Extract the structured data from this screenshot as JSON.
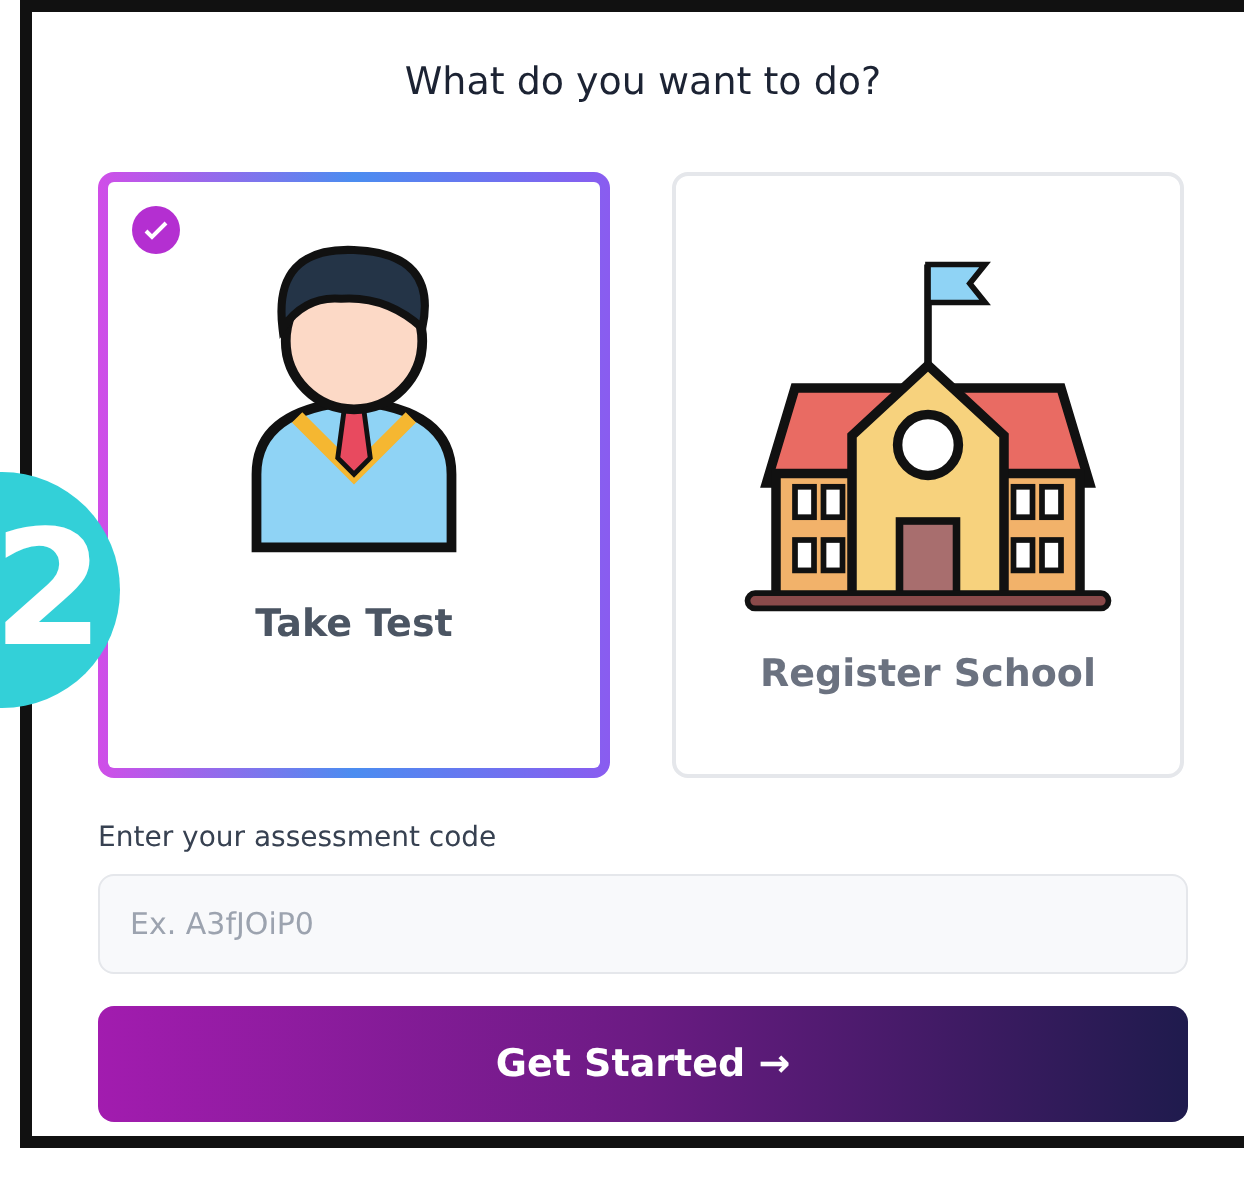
{
  "step_badge": "2",
  "title": "What do you want to do?",
  "options": [
    {
      "kind": "student",
      "label": "Take Test",
      "selected": true
    },
    {
      "kind": "school",
      "label": "Register School",
      "selected": false
    }
  ],
  "code_field": {
    "label": "Enter your assessment code",
    "placeholder": "Ex. A3fJOiP0"
  },
  "submit_button": "Get Started →"
}
